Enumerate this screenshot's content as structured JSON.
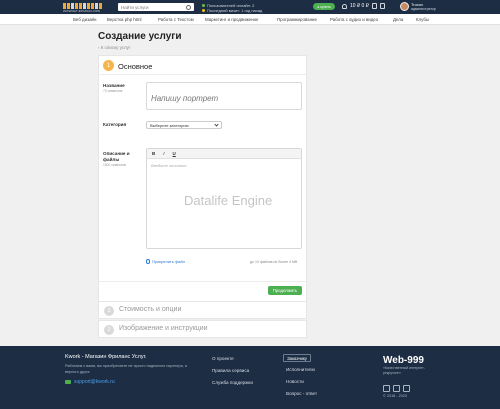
{
  "header": {
    "logo_text": "ИНТЕРНЕТ-ФРИЛАНС-КЛУБ",
    "search_placeholder": "Найти услуги",
    "online_users": "Пользователей онлайн: 2",
    "last_visit": "Последний визит: 1 год назад",
    "button_label": "● купить",
    "counter": "10 ₽ 0 ₽",
    "user_name": "Truxov",
    "user_role": "администратор"
  },
  "nav": {
    "items": [
      "Веб дизайн",
      "Верстка php html",
      "Работа с Текстом",
      "Маркетинг и продвижение",
      "Программирование",
      "Работа с аудио и видео",
      "Дела",
      "Клубы"
    ]
  },
  "page": {
    "title": "Создание услуги",
    "back_link": "‹ К списку услуг"
  },
  "step1": {
    "number": "1",
    "title": "Основное",
    "name_label": "Название",
    "name_hint": "70 символов",
    "name_placeholder": "Напишу портрет",
    "category_label": "Категория",
    "category_value": "Выберите категорию",
    "description_label": "Описание и файлы",
    "description_hint": "1500 символов",
    "description_placeholder": "Введите описание",
    "toolbar": {
      "bold": "B",
      "italic": "I",
      "underline": "U"
    },
    "watermark": "Datalife Engine",
    "attach_label": "Прикрепить файл",
    "attach_hint": "до 10 файлов не более 4 MB",
    "continue_label": "Продолжить"
  },
  "steps": [
    {
      "number": "2",
      "title": "Стоимость и опции"
    },
    {
      "number": "3",
      "title": "Изображение и инструкции"
    }
  ],
  "footer": {
    "title": "Kwork - Магазин Фриланс Услуг.",
    "text": "Работаем с вами, вы приобретаете не просто надежного партнера, а верного друга.",
    "email": "support@kwork.ru",
    "col1": [
      "О проекте",
      "Правила сервиса",
      "Служба поддержки"
    ],
    "col2": [
      "Заказчику",
      "Исполнителю",
      "Новости",
      "Вопрос - ответ"
    ],
    "brand": "Web-999",
    "brand_sub": "«Качественный интернет-рекрутинг»",
    "copyright": "© 2018 - 2020"
  }
}
